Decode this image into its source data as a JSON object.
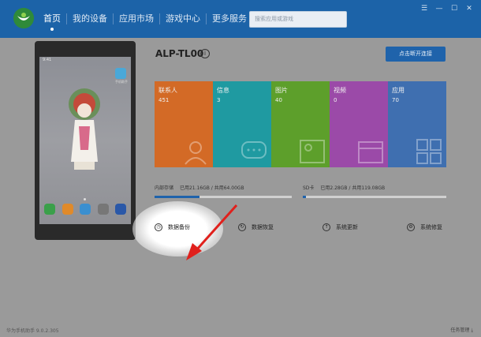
{
  "app": {
    "title": "华为手机助手"
  },
  "nav": {
    "items": [
      {
        "label": "首页",
        "active": true
      },
      {
        "label": "我的设备",
        "active": false
      },
      {
        "label": "应用市场",
        "active": false
      },
      {
        "label": "游戏中心",
        "active": false
      },
      {
        "label": "更多服务",
        "active": false
      }
    ]
  },
  "search": {
    "placeholder": "搜索应用或游戏"
  },
  "window_controls": {
    "menu": "☰",
    "minimize": "—",
    "maximize": "☐",
    "close": "✕"
  },
  "phone": {
    "time": "9:41",
    "app_label": "手机助手"
  },
  "device": {
    "name": "ALP-TL00",
    "info_icon": "i",
    "disconnect_label": "点击断开连接"
  },
  "tiles": [
    {
      "label": "联系人",
      "count": "451",
      "color": "#d36a26",
      "icon": "person-icon"
    },
    {
      "label": "信息",
      "count": "3",
      "color": "#1f9aa1",
      "icon": "chat-icon"
    },
    {
      "label": "图片",
      "count": "40",
      "color": "#5d9f2b",
      "icon": "image-icon"
    },
    {
      "label": "视频",
      "count": "0",
      "color": "#9b4aa8",
      "icon": "video-icon"
    },
    {
      "label": "应用",
      "count": "70",
      "color": "#3f6fb0",
      "icon": "apps-icon"
    }
  ],
  "storage": {
    "internal": {
      "name": "内部存储",
      "text": "已用21.16GB / 共用64.00GB",
      "fraction": 0.33
    },
    "sd": {
      "name": "SD卡",
      "text": "已用2.28GB / 共用119.08GB",
      "fraction": 0.02
    }
  },
  "actions": [
    {
      "label": "数据备份",
      "icon": "backup-icon",
      "glyph": "◷"
    },
    {
      "label": "数据恢复",
      "icon": "restore-icon",
      "glyph": "↻"
    },
    {
      "label": "系统更新",
      "icon": "update-icon",
      "glyph": "↑"
    },
    {
      "label": "系统修复",
      "icon": "repair-icon",
      "glyph": "⚙"
    }
  ],
  "footer": {
    "version": "华为手机助手 9.0.2.305",
    "task_manager": "任务管理"
  },
  "colors": {
    "titlebar": "#1c63a8",
    "accent": "#1f63ab",
    "arrow": "#e0201c"
  }
}
